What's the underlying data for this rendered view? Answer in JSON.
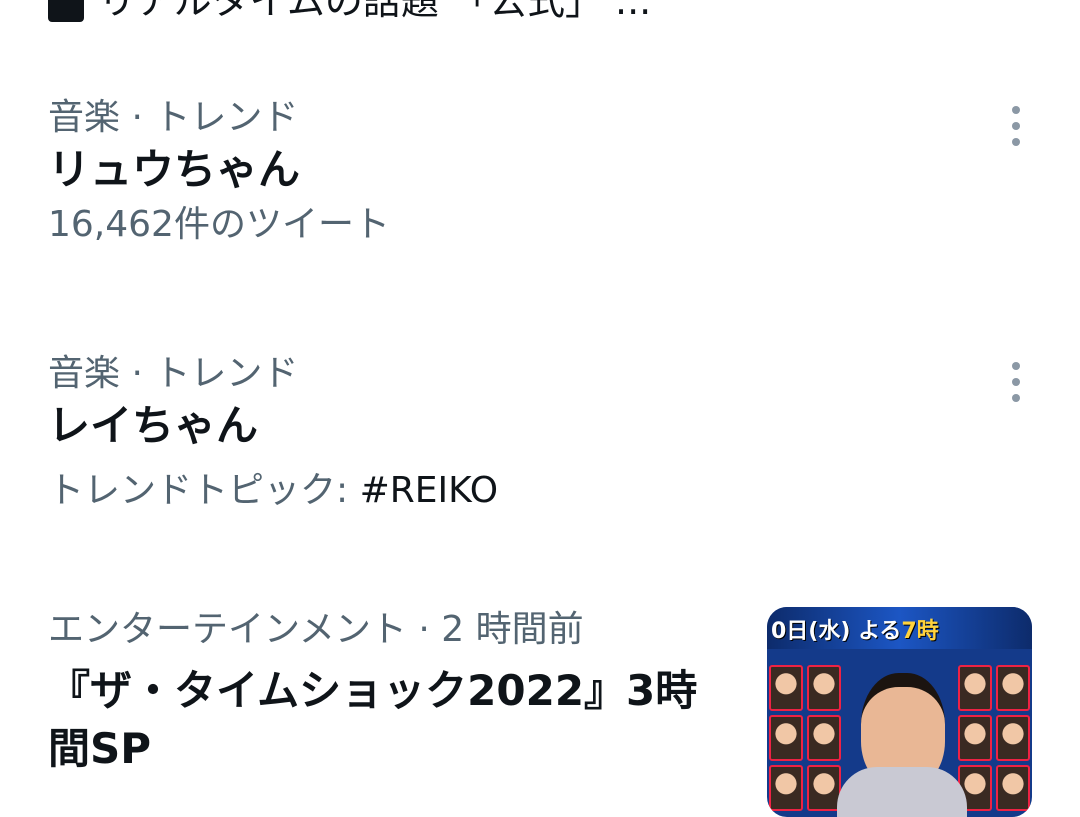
{
  "clipped_top_text": "リアルタイムの話題  「公式」 ...",
  "trends": [
    {
      "category": "音楽 · トレンド",
      "title": "リュウちゃん",
      "subtitle": "16,462件のツイート",
      "hashtag": ""
    },
    {
      "category": "音楽 · トレンド",
      "title": "レイちゃん",
      "subtitle": "トレンドトピック: ",
      "hashtag": "#REIKO"
    },
    {
      "category": "エンターテインメント · 2 時間前",
      "title_line1": "『ザ・タイムショック2022』3時",
      "title_line2": "間SP"
    }
  ],
  "thumbnail": {
    "band_prefix": "0日(水) よる",
    "band_num": "7時"
  },
  "colors": {
    "primary_text": "#0f1419",
    "secondary_text": "#536471",
    "icon": "#8b98a5"
  }
}
